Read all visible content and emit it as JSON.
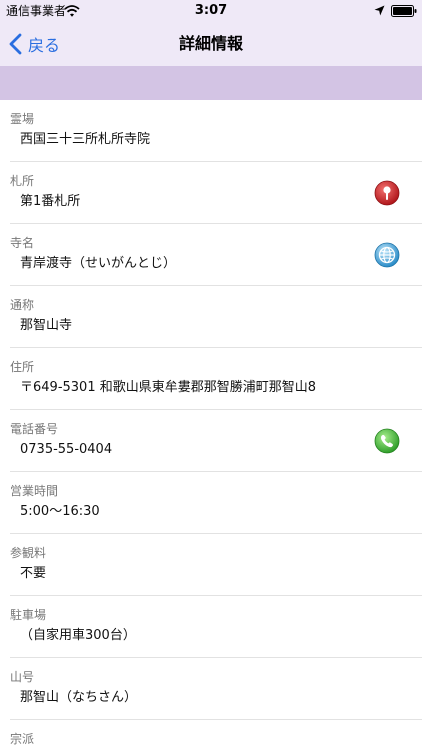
{
  "status_bar": {
    "carrier": "通信事業者",
    "time": "3:07"
  },
  "nav": {
    "back_label": "戻る",
    "title": "詳細情報"
  },
  "rows": [
    {
      "label": "霊場",
      "value": "西国三十三所札所寺院"
    },
    {
      "label": "札所",
      "value": "第1番札所",
      "action_icon": "map-pin-icon"
    },
    {
      "label": "寺名",
      "value": "青岸渡寺（せいがんとじ）",
      "action_icon": "globe-icon"
    },
    {
      "label": "通称",
      "value": "那智山寺"
    },
    {
      "label": "住所",
      "value": "〒649-5301 和歌山県東牟婁郡那智勝浦町那智山8"
    },
    {
      "label": "電話番号",
      "value": "0735-55-0404",
      "action_icon": "phone-icon"
    },
    {
      "label": "営業時間",
      "value": "5:00～16:30"
    },
    {
      "label": "参観料",
      "value": "不要"
    },
    {
      "label": "駐車場",
      "value": "（自家用車300台）"
    },
    {
      "label": "山号",
      "value": "那智山（なちさん）"
    },
    {
      "label": "宗派",
      "value": ""
    }
  ],
  "colors": {
    "topbar": "#efe9f7",
    "band": "#d3c4e4",
    "accent": "#2a6ee0",
    "pin": "#c8262a",
    "globe": "#3aa0d8",
    "phone": "#3fb83a"
  }
}
